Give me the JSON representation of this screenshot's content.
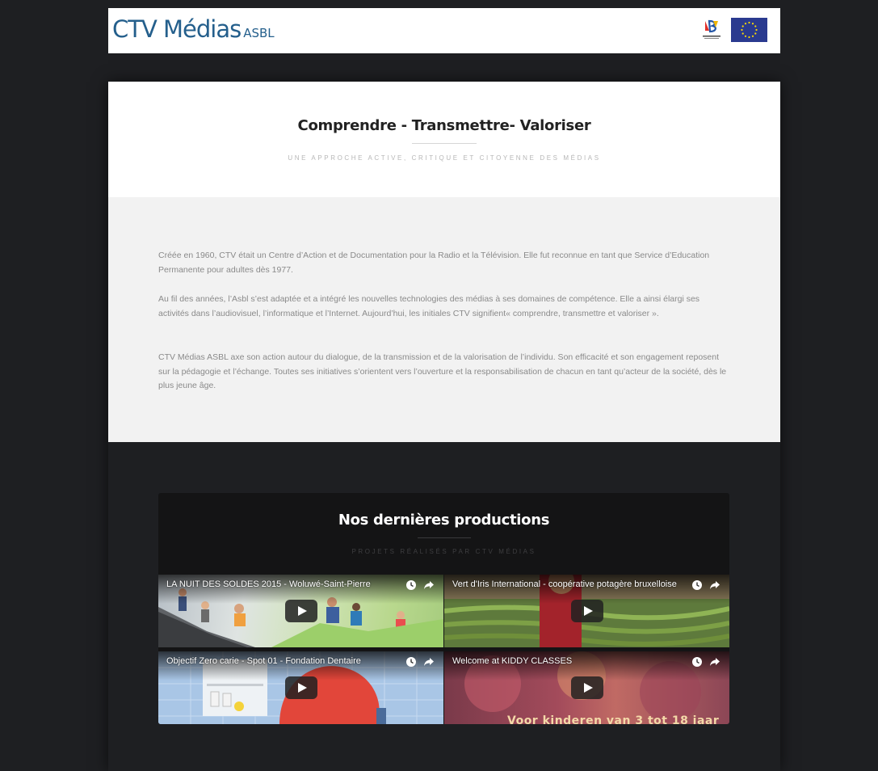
{
  "header": {
    "logo_main": "CTV Médias",
    "logo_sub": "ASBL"
  },
  "hero": {
    "title": "Comprendre - Transmettre- Valoriser",
    "subtitle": "UNE APPROCHE ACTIVE, CRITIQUE ET CITOYENNE DES MÉDIAS"
  },
  "about": {
    "paragraphs": [
      "Créée en 1960, CTV était un Centre d’Action et de Documentation pour la Radio et la Télévision. Elle fut reconnue en tant que Service d’Education Permanente pour adultes dès 1977.",
      "Au fil des années, l’Asbl s’est adaptée et a intégré les nouvelles technologies des médias à ses domaines de compétence. Elle a ainsi élargi ses activités dans l’audiovisuel, l’informatique et l’Internet. Aujourd’hui, les initiales CTV signifient« comprendre, transmettre et valoriser ».",
      "CTV Médias ASBL axe son action autour du dialogue, de la transmission et de la valorisation de l’individu. Son efficacité et son engagement reposent sur la pédagogie et l’échange. Toutes ses initiatives s’orientent vers l’ouverture et la responsabilisation de chacun en tant qu’acteur de la société, dès le plus jeune âge."
    ]
  },
  "productions": {
    "title": "Nos dernières productions",
    "subtitle": "PROJETS RÉALISÉS PAR CTV MÉDIAS",
    "videos": [
      {
        "title": "LA NUIT DES SOLDES 2015 - Woluwé-Saint-Pierre"
      },
      {
        "title": "Vert d'Iris International - coopérative potagère bruxelloise"
      },
      {
        "title": "Objectif Zero carie - Spot 01 - Fondation Dentaire"
      },
      {
        "title": "Welcome at KIDDY CLASSES",
        "overlay_text": "Voor kinderen van 3 tot 18 jaar"
      }
    ]
  },
  "icons": {
    "watch_later": "clock-icon",
    "share": "share-icon",
    "play": "play-icon"
  },
  "colors": {
    "background": "#1e1f22",
    "logo_blue": "#245f8c",
    "eu_blue": "#2a3a8f",
    "eu_star": "#ffdd00"
  }
}
